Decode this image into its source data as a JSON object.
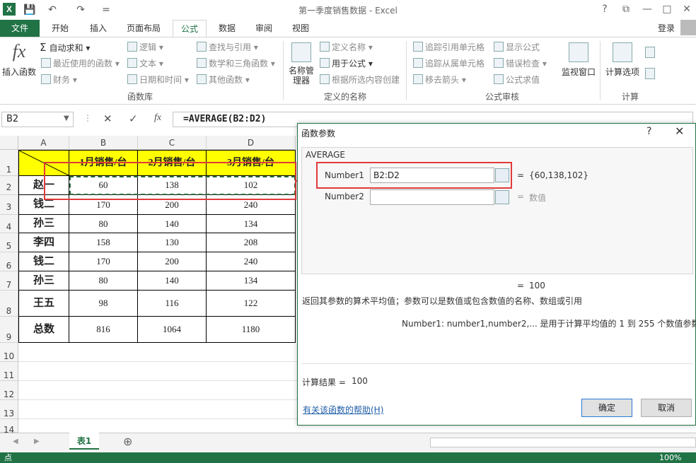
{
  "titlebar": {
    "app_icon": "X",
    "save_icon": "💾",
    "undo_icon": "↶",
    "redo_icon": "↷",
    "customize_icon": "=",
    "title": "第一季度销售数据 - Excel",
    "help": "?",
    "restore_icon": "⧉",
    "minimize": "—",
    "maximize": "□",
    "close": "✕"
  },
  "tabs": [
    "文件",
    "开始",
    "插入",
    "页面布局",
    "公式",
    "数据",
    "审阅",
    "视图"
  ],
  "login": "登录",
  "ribbon": {
    "insert_function": "插入函数",
    "autosum": "自动求和",
    "recent": "最近使用的函数",
    "financial": "财务",
    "logical": "逻辑",
    "text": "文本",
    "datetime": "日期和时间",
    "lookup": "查找与引用",
    "math": "数学和三角函数",
    "other": "其他函数",
    "group_library": "函数库",
    "name_manager": "名称管理器",
    "define_name": "定义名称",
    "use_in_formula": "用于公式",
    "create_from_selection": "根据所选内容创建",
    "group_names": "定义的名称",
    "trace_precedents": "追踪引用单元格",
    "trace_dependents": "追踪从属单元格",
    "remove_arrows": "移去箭头",
    "show_formulas": "显示公式",
    "error_checking": "错误检查",
    "evaluate_formula": "公式求值",
    "group_audit": "公式审核",
    "watch_window": "监视窗口",
    "calc_options": "计算选项",
    "group_calc": "计算"
  },
  "formula_bar": {
    "name_box": "B2",
    "cancel": "✕",
    "enter": "✓",
    "fx": "fx",
    "formula": "=AVERAGE(B2:D2)"
  },
  "sheet": {
    "columns": [
      "A",
      "B",
      "C",
      "D"
    ],
    "row_numbers": [
      "1",
      "2",
      "3",
      "4",
      "5",
      "6",
      "7",
      "8",
      "9",
      "10",
      "11",
      "12",
      "13",
      "14"
    ],
    "headers": [
      "1月销售/台",
      "2月销售/台",
      "3月销售/台"
    ],
    "rows": [
      {
        "name": "赵一",
        "b": "60",
        "c": "138",
        "d": "102"
      },
      {
        "name": "钱二",
        "b": "170",
        "c": "200",
        "d": "240"
      },
      {
        "name": "孙三",
        "b": "80",
        "c": "140",
        "d": "134"
      },
      {
        "name": "李四",
        "b": "158",
        "c": "130",
        "d": "208"
      },
      {
        "name": "钱二",
        "b": "170",
        "c": "200",
        "d": "240"
      },
      {
        "name": "孙三",
        "b": "80",
        "c": "140",
        "d": "134"
      },
      {
        "name": "王五",
        "b": "98",
        "c": "116",
        "d": "122"
      },
      {
        "name": "总数",
        "b": "816",
        "c": "1064",
        "d": "1180"
      }
    ],
    "tab_name": "表1",
    "add_sheet": "⊕"
  },
  "status": {
    "mode": "点",
    "zoom": "100%"
  },
  "dialog": {
    "title": "函数参数",
    "help": "?",
    "close": "✕",
    "function_name": "AVERAGE",
    "arg1_label": "Number1",
    "arg1_value": "B2:D2",
    "arg1_result": "{60,138,102}",
    "arg2_label": "Number2",
    "arg2_value": "",
    "arg2_result": "数值",
    "equals": "=",
    "result_value": "100",
    "description": "返回其参数的算术平均值；参数可以是数值或包含数值的名称、数组或引用",
    "arg_description": "Number1:  number1,number2,... 是用于计算平均值的 1 到 255 个数值参数",
    "calc_result_label": "计算结果 =",
    "calc_result_value": "100",
    "help_link": "有关该函数的帮助(H)",
    "ok": "确定",
    "cancel": "取消"
  },
  "colors": {
    "excel_green": "#217346",
    "header_yellow": "#ffff00",
    "annotation_red": "#e03a3a"
  }
}
